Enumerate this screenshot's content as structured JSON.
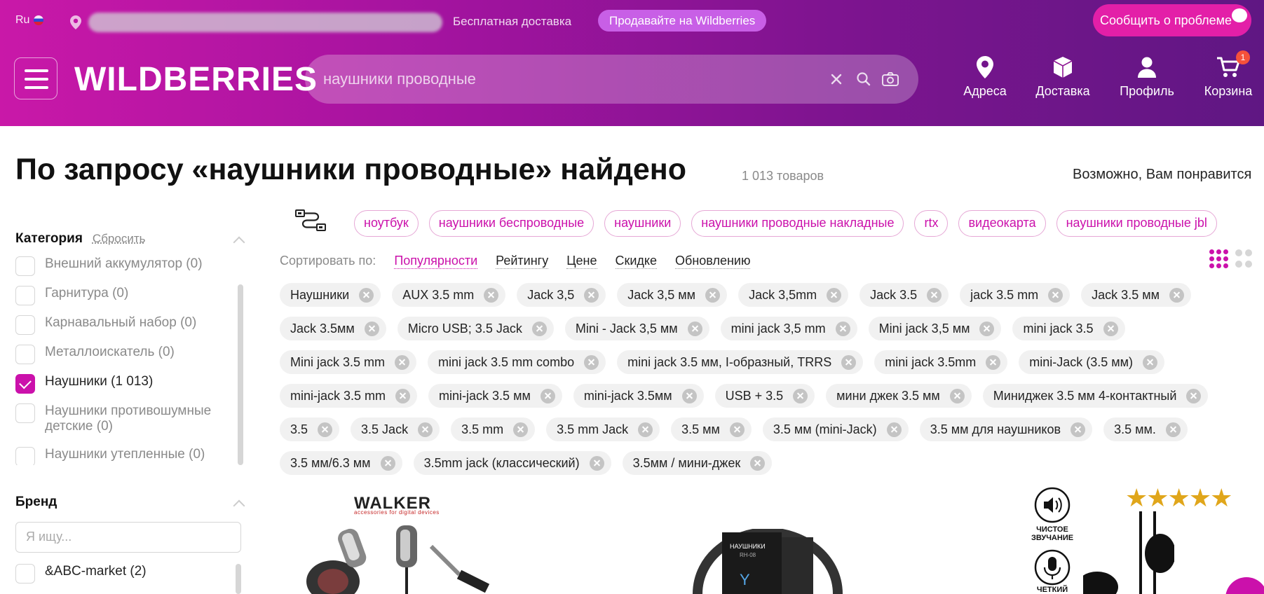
{
  "topbar": {
    "lang": "Ru",
    "free_delivery": "Бесплатная доставка",
    "sell": "Продавайте на Wildberries",
    "report": "Сообщить о проблеме"
  },
  "header": {
    "logo": "WILDBERRIES",
    "search_value": "наушники проводные",
    "nav": [
      {
        "label": "Адреса",
        "icon": "location-pin-icon"
      },
      {
        "label": "Доставка",
        "icon": "box-icon"
      },
      {
        "label": "Профиль",
        "icon": "user-icon"
      },
      {
        "label": "Корзина",
        "icon": "cart-icon",
        "badge": "1"
      }
    ]
  },
  "results": {
    "title": "По запросу «наушники проводные» найдено",
    "count": "1 013 товаров",
    "maybe_like": "Возможно, Вам понравится"
  },
  "sidebar": {
    "category_title": "Категория",
    "reset": "Сбросить",
    "categories": [
      {
        "label": "Внешний аккумулятор (0)",
        "checked": false
      },
      {
        "label": "Гарнитура (0)",
        "checked": false
      },
      {
        "label": "Карнавальный набор (0)",
        "checked": false
      },
      {
        "label": "Металлоискатель (0)",
        "checked": false
      },
      {
        "label": "Наушники (1 013)",
        "checked": true
      },
      {
        "label": "Наушники противошумные детские (0)",
        "checked": false
      },
      {
        "label": "Наушники утепленные (0)",
        "checked": false
      }
    ],
    "brand_title": "Бренд",
    "brand_placeholder": "Я ищу...",
    "brands": [
      {
        "label": "&ABC-market (2)",
        "checked": false
      }
    ]
  },
  "related": [
    "ноутбук",
    "наушники беспроводные",
    "наушники",
    "наушники проводные накладные",
    "rtx",
    "видеокарта",
    "наушники проводные jbl"
  ],
  "sort": {
    "label": "Сортировать по:",
    "options": [
      "Популярности",
      "Рейтингу",
      "Цене",
      "Скидке",
      "Обновлению"
    ],
    "active": 0
  },
  "filters": [
    "Наушники",
    "AUX 3.5 mm",
    "Jack 3,5",
    "Jack 3,5 мм",
    "Jack 3,5mm",
    "Jack 3.5",
    "jack 3.5 mm",
    "Jack 3.5 мм",
    "Jack 3.5мм",
    "Micro USB; 3.5 Jack",
    "Mini - Jack 3,5 мм",
    "mini jack 3,5 mm",
    "Mini jack 3,5 мм",
    "mini jack 3.5",
    "Mini jack 3.5 mm",
    "mini jack 3.5 mm combo",
    "mini jack 3.5 мм, I-образный, TRRS",
    "mini jack 3.5mm",
    "mini-Jack (3.5 мм)",
    "mini-jack 3.5 mm",
    "mini-jack 3.5 мм",
    "mini-jack 3.5мм",
    "USB + 3.5",
    "мини джек 3.5 мм",
    "Миниджек 3.5 мм 4-контактный",
    "3.5",
    "3.5 Jack",
    "3.5 mm",
    "3.5 mm Jack",
    "3.5 мм",
    "3.5 мм (mini-Jack)",
    "3.5 мм для наушников",
    "3.5 мм.",
    "3.5 мм/6.3 мм",
    "3.5mm jack (классический)",
    "3.5мм / мини-джек"
  ],
  "products": {
    "brand_logo": "WALKER",
    "brand_sub": "accessories for digital devices",
    "box_label_1": "НАУШНИКИ",
    "box_label_2": "RH-08",
    "feature_1": "ЧИСТОЕ ЗВУЧАНИЕ",
    "feature_2": "ЧЕТКИЙ",
    "stars": "★★★★★"
  },
  "colors": {
    "accent": "#cb11ab",
    "header_start": "#c918a8",
    "header_end": "#5f1783"
  }
}
